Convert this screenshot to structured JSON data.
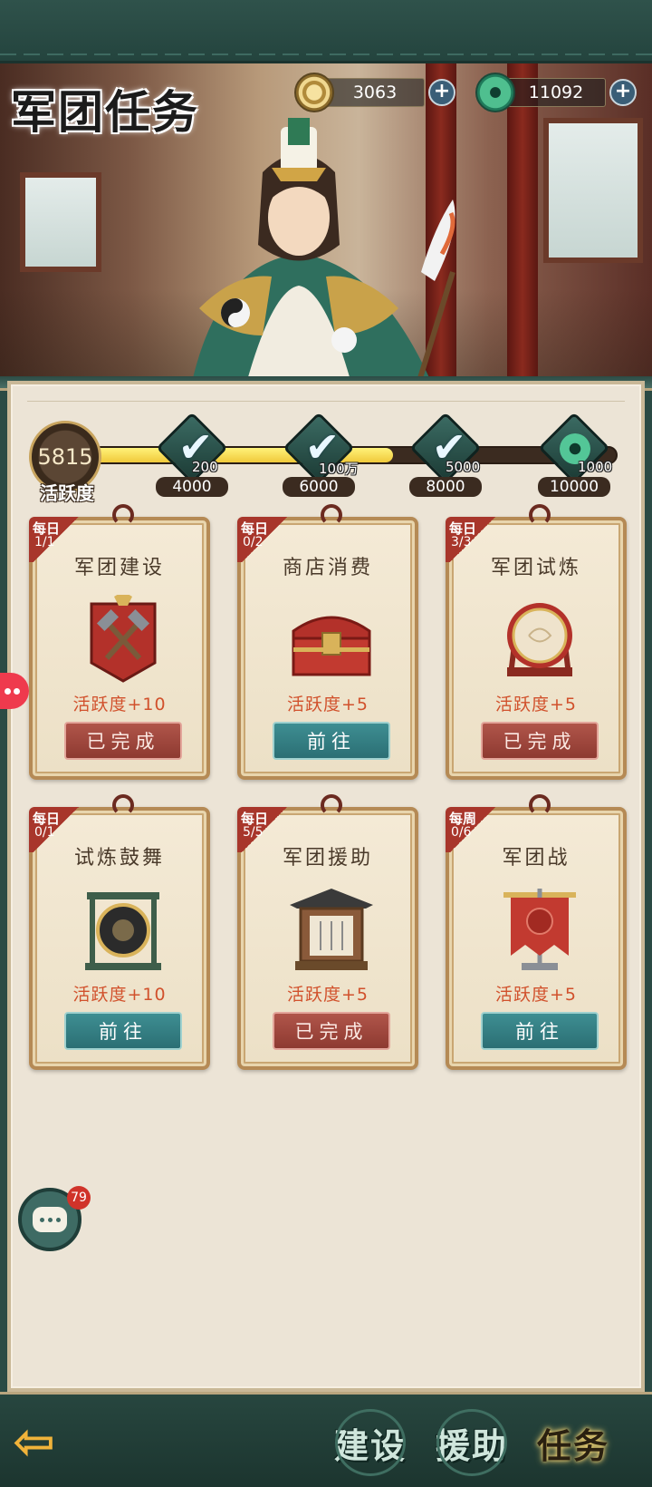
{
  "header": {
    "title": "军团任务"
  },
  "currencies": [
    {
      "icon": "coin-icon",
      "value": "3063"
    },
    {
      "icon": "jade-icon",
      "value": "11092"
    }
  ],
  "activity": {
    "current": "5815",
    "label": "活跃度",
    "progress_fraction": 0.58,
    "milestones": [
      {
        "threshold": "4000",
        "reward": "200",
        "claimed": true
      },
      {
        "threshold": "6000",
        "reward": "100万",
        "claimed": true
      },
      {
        "threshold": "8000",
        "reward": "5000",
        "claimed": true
      },
      {
        "threshold": "10000",
        "reward": "1000",
        "claimed": false
      }
    ]
  },
  "tasks": [
    {
      "type": "每日",
      "count": "1/1",
      "title": "军团建设",
      "points": "活跃度+10",
      "button": "已完成",
      "status": "done",
      "art": "hammer-banner-icon"
    },
    {
      "type": "每日",
      "count": "0/2",
      "title": "商店消费",
      "points": "活跃度+5",
      "button": "前往",
      "status": "go",
      "art": "treasure-chest-icon"
    },
    {
      "type": "每日",
      "count": "3/3",
      "title": "军团试炼",
      "points": "活跃度+5",
      "button": "已完成",
      "status": "done",
      "art": "war-drum-icon"
    },
    {
      "type": "每日",
      "count": "0/1",
      "title": "试炼鼓舞",
      "points": "活跃度+10",
      "button": "前往",
      "status": "go",
      "art": "gong-icon"
    },
    {
      "type": "每日",
      "count": "5/5",
      "title": "军团援助",
      "points": "活跃度+5",
      "button": "已完成",
      "status": "done",
      "art": "shrine-icon"
    },
    {
      "type": "每周",
      "count": "0/6",
      "title": "军团战",
      "points": "活跃度+5",
      "button": "前往",
      "status": "go",
      "art": "war-flag-icon"
    }
  ],
  "chat": {
    "badge": "79"
  },
  "nav": {
    "tabs": [
      {
        "label": "建设",
        "active": false
      },
      {
        "label": "援助",
        "active": false
      },
      {
        "label": "任务",
        "active": true
      }
    ]
  },
  "colors": {
    "accent_teal": "#2b6f74",
    "done_red": "#8e3a31",
    "points_orange": "#d1512c",
    "frame_gold": "#b58a55"
  }
}
